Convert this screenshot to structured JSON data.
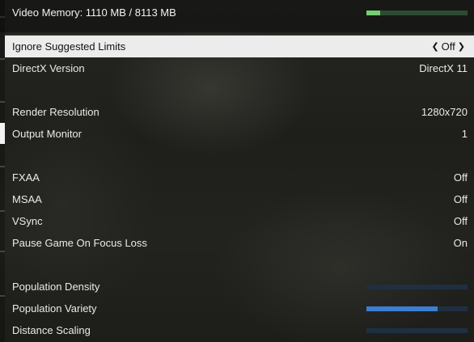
{
  "video_memory": {
    "label": "Video Memory: 1110 MB / 8113 MB",
    "used_fraction": 0.137,
    "fill_color": "#72cf72"
  },
  "settings": {
    "ignore_limits": {
      "label": "Ignore Suggested Limits",
      "value": "Off",
      "left_icon": "chevron-left-icon",
      "right_icon": "chevron-right-icon"
    },
    "directx": {
      "label": "DirectX Version",
      "value": "DirectX 11"
    },
    "render_resolution": {
      "label": "Render Resolution",
      "value": "1280x720"
    },
    "output_monitor": {
      "label": "Output Monitor",
      "value": "1"
    },
    "fxaa": {
      "label": "FXAA",
      "value": "Off"
    },
    "msaa": {
      "label": "MSAA",
      "value": "Off"
    },
    "vsync": {
      "label": "VSync",
      "value": "Off"
    },
    "pause_focus": {
      "label": "Pause Game On Focus Loss",
      "value": "On"
    },
    "population_density": {
      "label": "Population Density",
      "level": 0.0
    },
    "population_variety": {
      "label": "Population Variety",
      "level": 0.7
    },
    "distance_scaling": {
      "label": "Distance Scaling",
      "level": 0.0
    }
  },
  "colors": {
    "selected_row_bg": "#ececec",
    "slider_fill": "#3b7fd0",
    "slider_track": "#1f2f42"
  }
}
